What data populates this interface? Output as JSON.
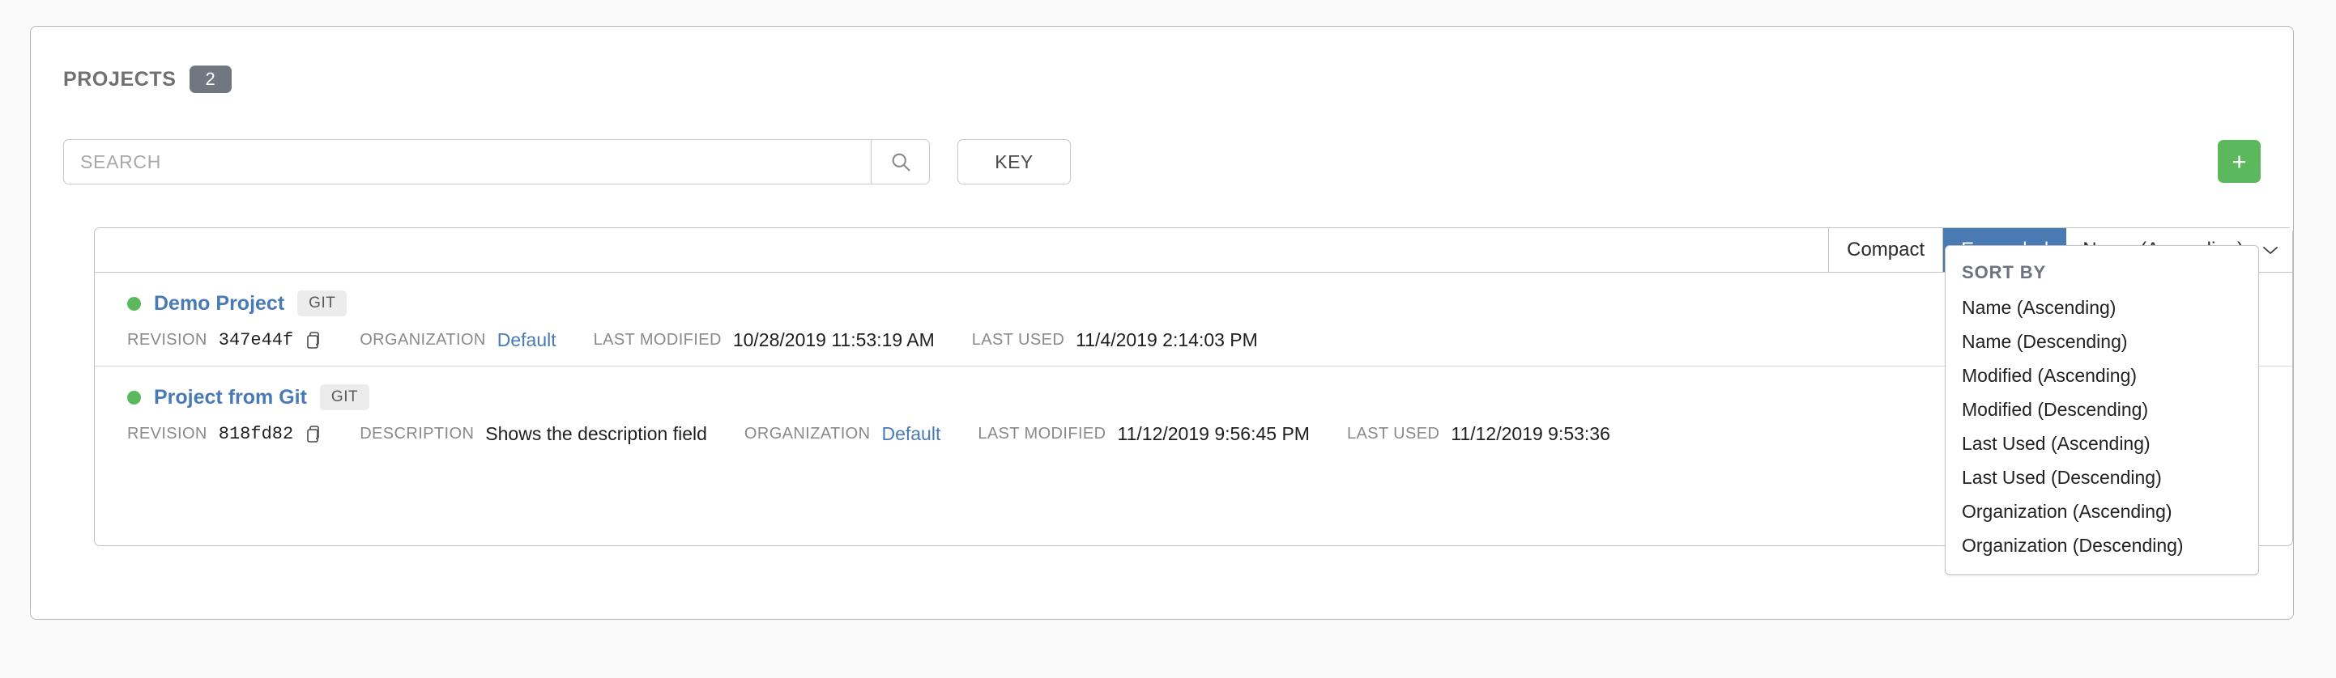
{
  "header": {
    "title": "PROJECTS",
    "count": "2"
  },
  "search": {
    "placeholder": "SEARCH",
    "value": "",
    "search_icon": "search-icon",
    "key_label": "KEY",
    "add_label": "+"
  },
  "toolbar": {
    "compact_label": "Compact",
    "expanded_label": "Expanded",
    "active_view": "Expanded",
    "sort_value": "Name (Ascending)",
    "chevron": "∨"
  },
  "dropdown": {
    "header": "SORT BY",
    "items": [
      {
        "label": "Name (Ascending)"
      },
      {
        "label": "Name (Descending)"
      },
      {
        "label": "Modified (Ascending)"
      },
      {
        "label": "Modified (Descending)"
      },
      {
        "label": "Last Used (Ascending)"
      },
      {
        "label": "Last Used (Descending)"
      },
      {
        "label": "Organization (Ascending)"
      },
      {
        "label": "Organization (Descending)"
      }
    ]
  },
  "labels": {
    "revision": "REVISION",
    "organization": "ORGANIZATION",
    "last_modified": "LAST MODIFIED",
    "last_used": "LAST USED",
    "description": "DESCRIPTION"
  },
  "projects": [
    {
      "name": "Demo Project",
      "scm_badge": "GIT",
      "status_color": "#5cb85c",
      "revision": "347e44f",
      "organization": "Default",
      "last_modified": "10/28/2019 11:53:19 AM",
      "last_used": "11/4/2019 2:14:03 PM"
    },
    {
      "name": "Project from Git",
      "scm_badge": "GIT",
      "status_color": "#5cb85c",
      "revision": "818fd82",
      "description": "Shows the description field",
      "organization": "Default",
      "last_modified": "11/12/2019 9:56:45 PM",
      "last_used": "11/12/2019 9:53:36"
    }
  ],
  "colors": {
    "accent_blue": "#4a7ab3",
    "green": "#5cb85c",
    "badge_gray": "#707780"
  }
}
